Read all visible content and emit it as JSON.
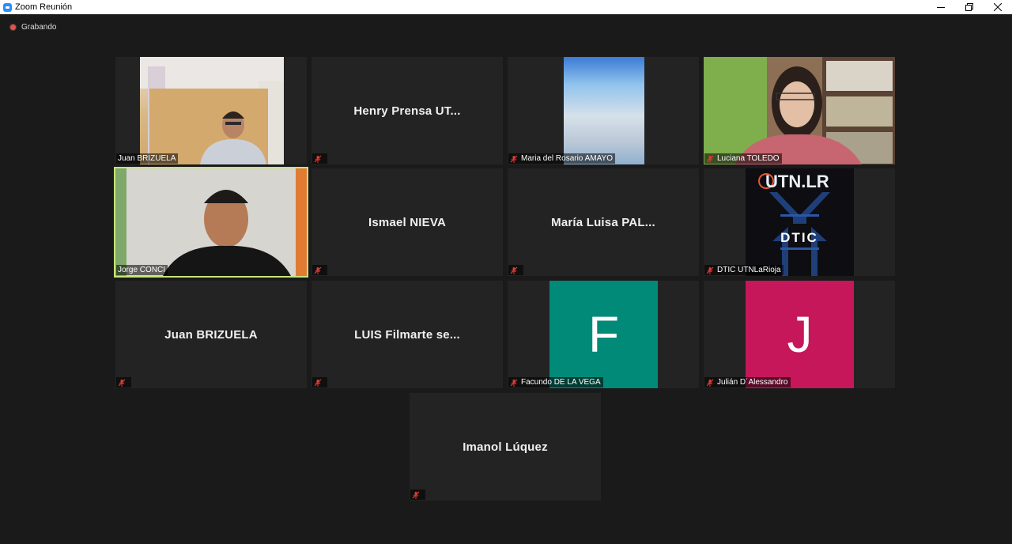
{
  "window": {
    "title": "Zoom Reunión"
  },
  "recording": {
    "label": "Grabando"
  },
  "tiles": [
    {
      "name": "Juan BRIZUELA",
      "type": "video"
    },
    {
      "name": "Henry Prensa UT...",
      "type": "name"
    },
    {
      "name": "Maria del Rosario AMAYO",
      "type": "video"
    },
    {
      "name": "Luciana TOLEDO",
      "type": "video"
    },
    {
      "name": "Jorge CONCI",
      "type": "video",
      "speaking": true
    },
    {
      "name": "Ismael NIEVA",
      "type": "name"
    },
    {
      "name": "María Luisa PAL...",
      "type": "name"
    },
    {
      "name": "DTIC UTNLaRioja",
      "type": "logo",
      "logo_text": "UTN.LR",
      "logo_sub": "DTIC"
    },
    {
      "name": "Juan BRIZUELA",
      "type": "name"
    },
    {
      "name": "LUIS Filmarte se...",
      "type": "name"
    },
    {
      "name": "Facundo DE LA VEGA",
      "type": "avatar",
      "initial": "F",
      "color": "#008a77"
    },
    {
      "name": "Julián D´Alessandro",
      "type": "avatar",
      "initial": "J",
      "color": "#c5175a"
    },
    {
      "name": "Imanol Lúquez",
      "type": "name"
    }
  ],
  "colors": {
    "active_speaker": "#c6e37a",
    "mute": "#e03c31",
    "recording": "#e4514b"
  }
}
